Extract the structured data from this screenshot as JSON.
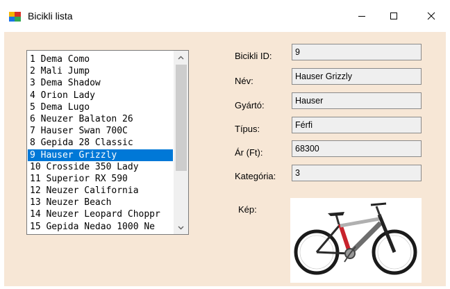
{
  "window": {
    "title": "Bicikli lista"
  },
  "list": {
    "items": [
      "1 Dema Como",
      "2 Mali Jump",
      "3 Dema Shadow",
      "4 Orion Lady",
      "5 Dema Lugo",
      "6 Neuzer Balaton 26",
      "7 Hauser Swan 700C",
      "8 Gepida 28 Classic",
      "9 Hauser Grizzly",
      "10 Crosside 350 Lady",
      "11 Superior RX 590",
      "12 Neuzer California",
      "13 Neuzer Beach",
      "14 Neuzer Leopard Choppr",
      "15 Gepida Nedao 1000 Ne"
    ],
    "selected_index": 8
  },
  "details": {
    "id_label": "Bicikli ID:",
    "id_value": "9",
    "name_label": "Név:",
    "name_value": "Hauser Grizzly",
    "maker_label": "Gyártó:",
    "maker_value": "Hauser",
    "type_label": "Típus:",
    "type_value": "Férfi",
    "price_label": "Ár (Ft):",
    "price_value": "68300",
    "category_label": "Kategória:",
    "category_value": "3",
    "image_label": "Kép:"
  },
  "colors": {
    "client_bg": "#f7e7d6",
    "selection": "#0078d7",
    "field_bg": "#efefef"
  },
  "icons": [
    "app-icon",
    "minimize-icon",
    "maximize-icon",
    "close-icon",
    "scroll-up-icon",
    "scroll-down-icon"
  ]
}
